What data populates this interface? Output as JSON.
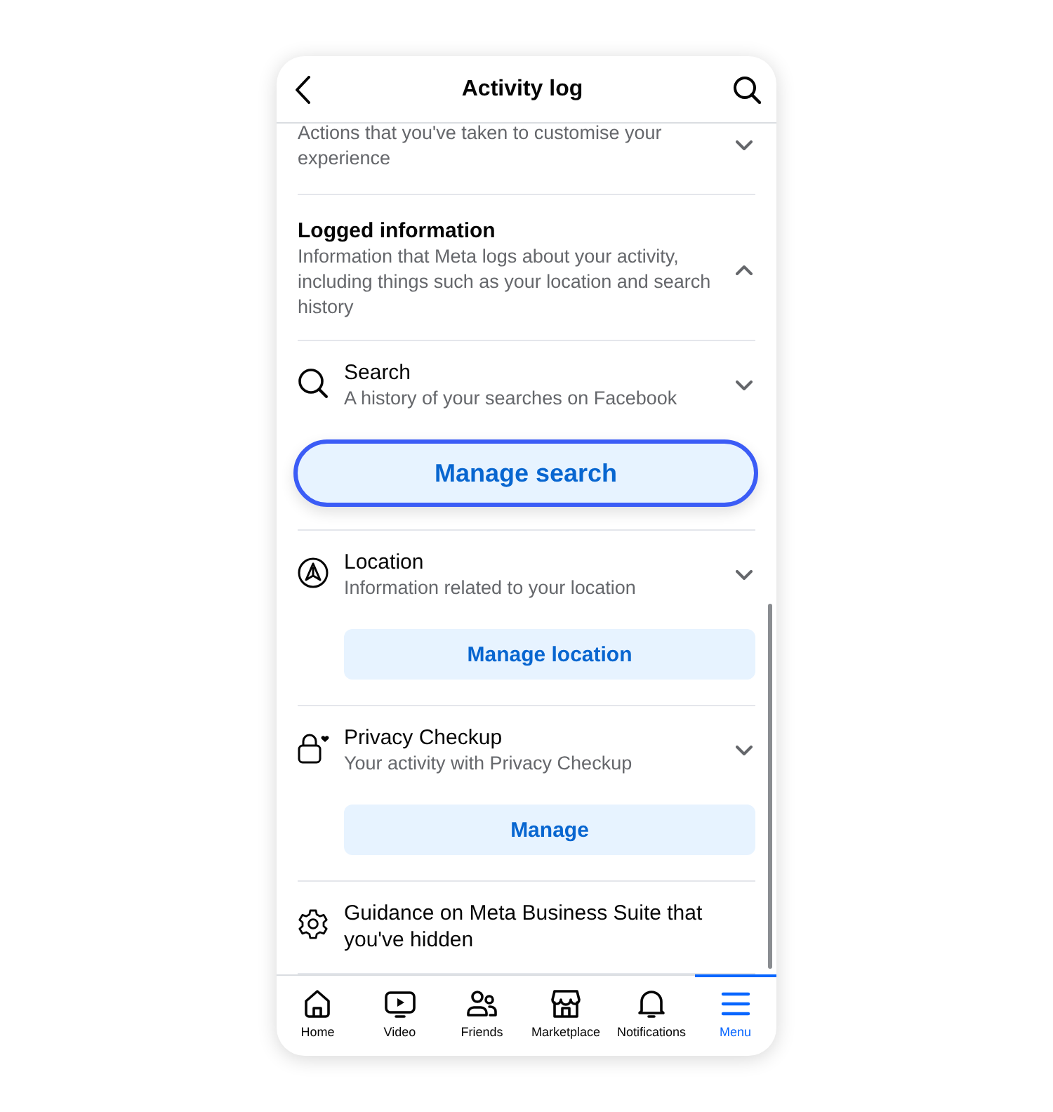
{
  "header": {
    "title": "Activity log"
  },
  "partial_item": {
    "description": "Actions that you've taken to customise your experience",
    "expanded": false
  },
  "section": {
    "title": "Logged information",
    "description": "Information that Meta logs about your activity, including things such as your location and search history",
    "expanded": true
  },
  "items": [
    {
      "kind": "search",
      "title": "Search",
      "description": "A history of your searches on Facebook",
      "expanded": false,
      "button": {
        "label": "Manage search",
        "focused": true
      }
    },
    {
      "kind": "location",
      "title": "Location",
      "description": "Information related to your location",
      "expanded": false,
      "button": {
        "label": "Manage location",
        "focused": false
      }
    },
    {
      "kind": "lock",
      "title": "Privacy Checkup",
      "description": "Your activity with Privacy Checkup",
      "expanded": false,
      "button": {
        "label": "Manage",
        "focused": false
      }
    },
    {
      "kind": "gear",
      "title": "Guidance on Meta Business Suite that you've hidden"
    }
  ],
  "nav": [
    {
      "kind": "home",
      "label": "Home",
      "selected": false
    },
    {
      "kind": "video",
      "label": "Video",
      "selected": false
    },
    {
      "kind": "friends",
      "label": "Friends",
      "selected": false
    },
    {
      "kind": "marketplace",
      "label": "Marketplace",
      "selected": false
    },
    {
      "kind": "bell",
      "label": "Notifications",
      "selected": false
    },
    {
      "kind": "menu",
      "label": "Menu",
      "selected": true
    }
  ]
}
